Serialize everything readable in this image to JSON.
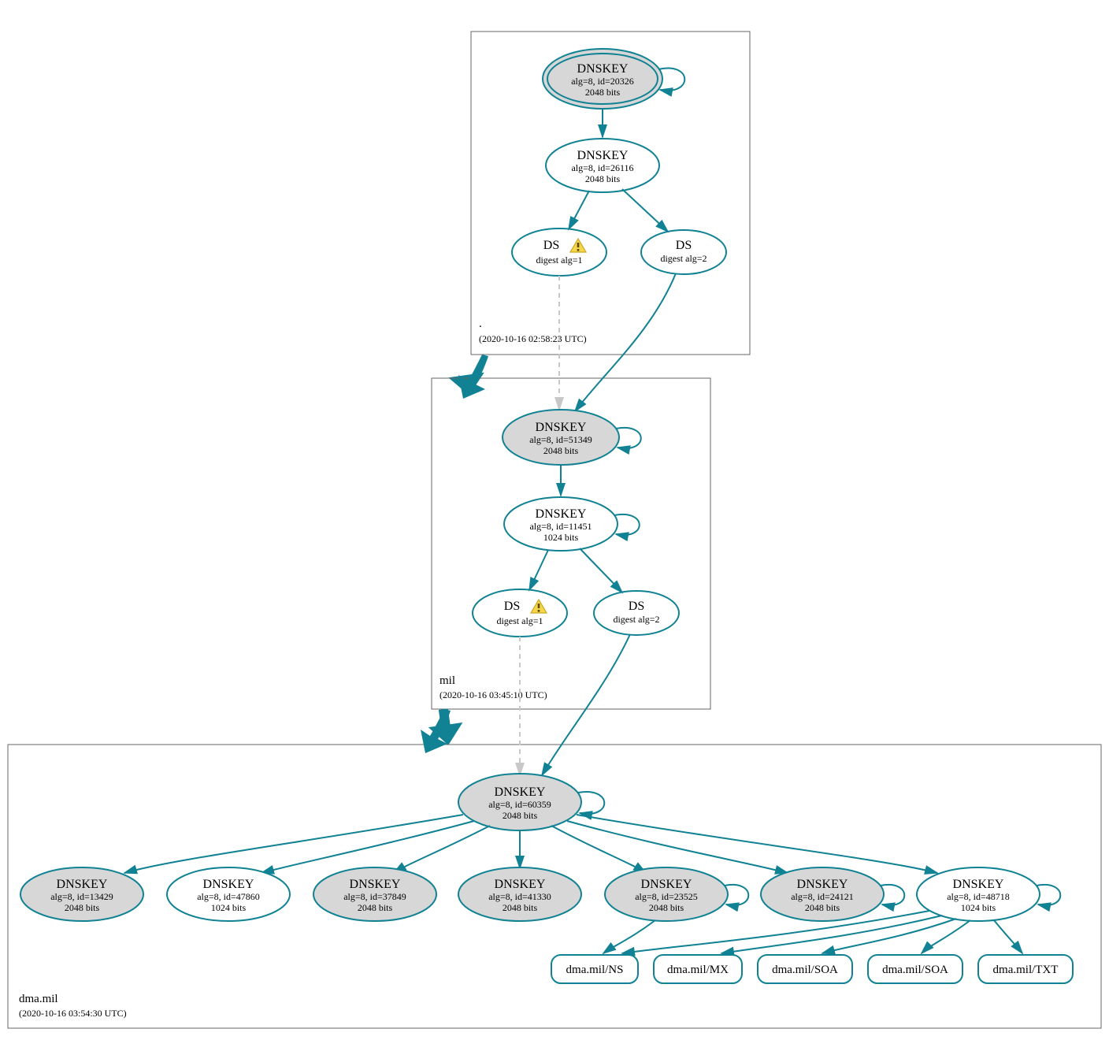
{
  "colors": {
    "accent": "#108294",
    "node_gray": "#d7d7d7",
    "dashed": "#c8c8c8"
  },
  "icons": {
    "warning": "warning-icon"
  },
  "zones": {
    "root": {
      "name": ".",
      "timestamp": "(2020-10-16 02:58:23 UTC)"
    },
    "mil": {
      "name": "mil",
      "timestamp": "(2020-10-16 03:45:10 UTC)"
    },
    "dma": {
      "name": "dma.mil",
      "timestamp": "(2020-10-16 03:54:30 UTC)"
    }
  },
  "nodes": {
    "root_ksk": {
      "title": "DNSKEY",
      "line2": "alg=8, id=20326",
      "line3": "2048 bits"
    },
    "root_zsk": {
      "title": "DNSKEY",
      "line2": "alg=8, id=26116",
      "line3": "2048 bits"
    },
    "root_ds1": {
      "title": "DS",
      "line2": "digest alg=1",
      "warning": true
    },
    "root_ds2": {
      "title": "DS",
      "line2": "digest alg=2"
    },
    "mil_ksk": {
      "title": "DNSKEY",
      "line2": "alg=8, id=51349",
      "line3": "2048 bits"
    },
    "mil_zsk": {
      "title": "DNSKEY",
      "line2": "alg=8, id=11451",
      "line3": "1024 bits"
    },
    "mil_ds1": {
      "title": "DS",
      "line2": "digest alg=1",
      "warning": true
    },
    "mil_ds2": {
      "title": "DS",
      "line2": "digest alg=2"
    },
    "dma_ksk": {
      "title": "DNSKEY",
      "line2": "alg=8, id=60359",
      "line3": "2048 bits"
    },
    "dma_k13429": {
      "title": "DNSKEY",
      "line2": "alg=8, id=13429",
      "line3": "2048 bits"
    },
    "dma_k47860": {
      "title": "DNSKEY",
      "line2": "alg=8, id=47860",
      "line3": "1024 bits"
    },
    "dma_k37849": {
      "title": "DNSKEY",
      "line2": "alg=8, id=37849",
      "line3": "2048 bits"
    },
    "dma_k41330": {
      "title": "DNSKEY",
      "line2": "alg=8, id=41330",
      "line3": "2048 bits"
    },
    "dma_k23525": {
      "title": "DNSKEY",
      "line2": "alg=8, id=23525",
      "line3": "2048 bits"
    },
    "dma_k24121": {
      "title": "DNSKEY",
      "line2": "alg=8, id=24121",
      "line3": "2048 bits"
    },
    "dma_k48718": {
      "title": "DNSKEY",
      "line2": "alg=8, id=48718",
      "line3": "1024 bits"
    }
  },
  "rrsets": {
    "ns": {
      "label": "dma.mil/NS"
    },
    "mx": {
      "label": "dma.mil/MX"
    },
    "soa1": {
      "label": "dma.mil/SOA"
    },
    "soa2": {
      "label": "dma.mil/SOA"
    },
    "txt": {
      "label": "dma.mil/TXT"
    }
  }
}
